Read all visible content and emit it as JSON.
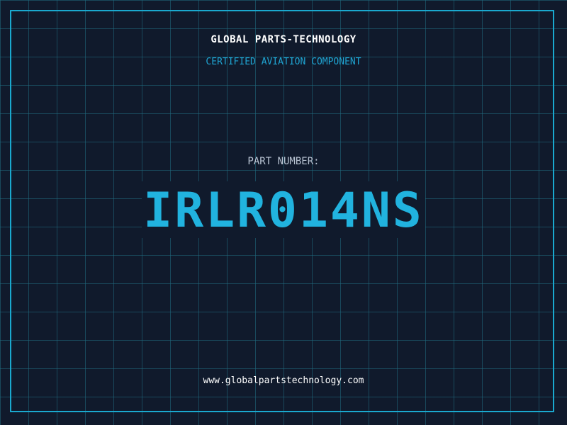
{
  "header": {
    "company": "GLOBAL PARTS-TECHNOLOGY",
    "tagline": "CERTIFIED AVIATION COMPONENT"
  },
  "part": {
    "label": "PART NUMBER:",
    "number": "IRLR014NS"
  },
  "footer": {
    "url": "www.globalpartstechnology.com"
  },
  "colors": {
    "background": "#101a2c",
    "grid": "#1e6e82",
    "accent": "#21b3df",
    "frame": "#1aa9cf"
  }
}
